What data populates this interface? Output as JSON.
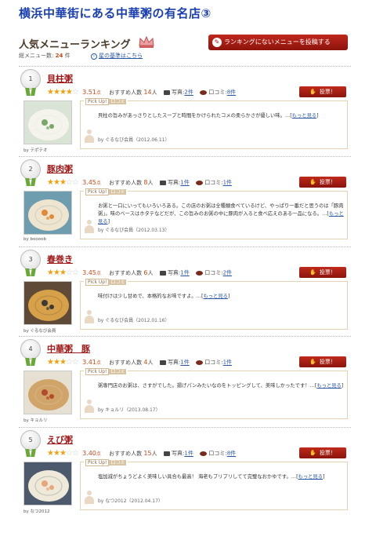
{
  "page": {
    "title": "横浜中華街にある中華粥の有名店③"
  },
  "ranking": {
    "title": "人気メニューランキング",
    "count_label": "総メニュー数:",
    "count_value": "24",
    "count_unit": "件",
    "basis_link": "星の基準はこちら",
    "post_button": "ランキングにないメニューを投稿する"
  },
  "common": {
    "rec_label": "おすすめ人数",
    "rec_unit": "人",
    "photo_label": "写真:",
    "review_label": "口コミ:",
    "vote_label": "投票！",
    "pickup": "Pick Up!",
    "kuchikomi": "口コミ",
    "more": "もっと見る",
    "score_unit": "点"
  },
  "items": [
    {
      "rank": "1",
      "name": "貝柱粥",
      "rating": 3.51,
      "score": "3.51",
      "rec": "14",
      "photos": "2件",
      "reviews": "8件",
      "photo_by": "by テポテオ",
      "text": "貝柱の旨みがあっさりとしたスープと時間をかけられたコメの柔らかさが優しい味。…",
      "reviewer": "by ぐるなび会員（2012.06.11）",
      "photo_colors": [
        "#d9e4d6",
        "#f4f3ec",
        "#7aa66a"
      ]
    },
    {
      "rank": "2",
      "name": "豚肉粥",
      "rating": 3.45,
      "score": "3.45",
      "rec": "8",
      "photos": "1件",
      "reviews": "1件",
      "photo_by": "by boooob",
      "text": "お粥と一口にいってもいろいろある。この店のお粥は全種類食べているけど、やっぱり一番だと思うのは「豚肉粥」。味のベースはホタテなどだが、この旨みのお粥の中に豚肉が入ると食べ応えのある一品になる。…",
      "reviewer": "by ぐるなび会員（2012.03.13）",
      "photo_colors": [
        "#6f9db0",
        "#efe5cf",
        "#e08a3a"
      ]
    },
    {
      "rank": "3",
      "name": "春巻き",
      "rating": 3.45,
      "score": "3.45",
      "rec": "6",
      "photos": "1件",
      "reviews": "2件",
      "photo_by": "by ぐるなび会員",
      "text": "味付けは少し甘めで、本格的なお味ですよ。…",
      "reviewer": "by ぐるなび会員（2012.01.16）",
      "photo_colors": [
        "#5e4a36",
        "#d7a14a",
        "#3d3a36"
      ]
    },
    {
      "rank": "4",
      "name": "中華粥　豚",
      "rating": 3.41,
      "score": "3.41",
      "rec": "4",
      "photos": "1件",
      "reviews": "1件",
      "photo_by": "by キョルリ",
      "text": "粥専門店のお粥は、さすがでした。揚げパンみたいなのをトッピングして、美味しかったです！…",
      "reviewer": "by キョルリ（2013.08.17）",
      "photo_colors": [
        "#e6e0d2",
        "#d1a46a",
        "#b34a2a"
      ]
    },
    {
      "rank": "5",
      "name": "えび粥",
      "rating": 3.4,
      "score": "3.40",
      "rec": "15",
      "photos": "1件",
      "reviews": "8件",
      "photo_by": "by なつ2012",
      "text": "塩加減がちょうどよく美味しい具合も最高！ 海老もプリプリしてて完璧なおかゆです。…",
      "reviewer": "by なつ2012（2012.04.17）",
      "photo_colors": [
        "#4d5a6e",
        "#efe9d9",
        "#e6a77a"
      ]
    }
  ]
}
